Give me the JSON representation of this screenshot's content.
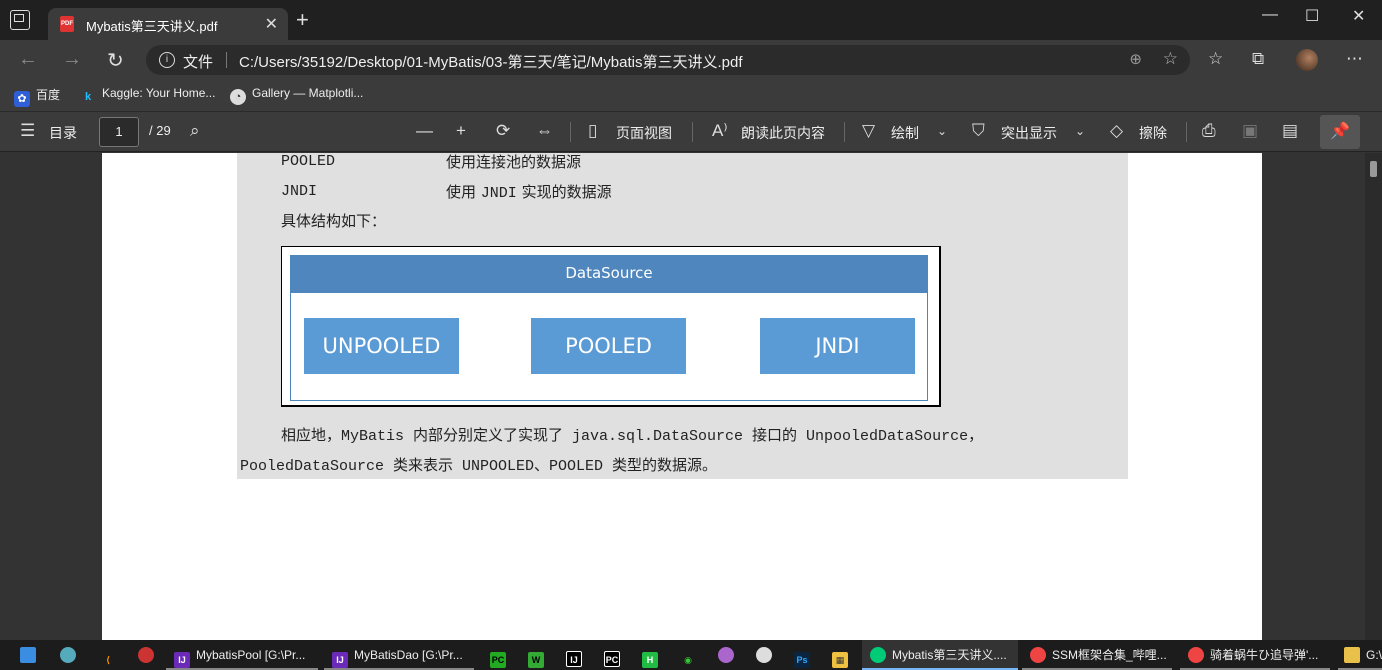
{
  "tab": {
    "title": "Mybatis第三天讲义.pdf",
    "icon": "pdf-icon",
    "icon_text": "PDF",
    "close": "✕"
  },
  "window": {
    "new_tab": "+",
    "minimize": "—",
    "maximize": "☐",
    "close": "✕"
  },
  "address": {
    "scheme_label": "文件",
    "url": "C:/Users/35192/Desktop/01-MyBatis/03-第三天/笔记/Mybatis第三天讲义.pdf"
  },
  "bookmarks": [
    {
      "label": "百度",
      "icon": "baidu-icon"
    },
    {
      "label": "Kaggle: Your Home...",
      "icon": "kaggle-icon"
    },
    {
      "label": "Gallery — Matplotli...",
      "icon": "matplotlib-icon"
    }
  ],
  "pdf_toolbar": {
    "toc_label": "目录",
    "page_current": "1",
    "page_total": "/ 29",
    "page_view_label": "页面视图",
    "read_aloud_label": "朗读此页内容",
    "draw_label": "绘制",
    "highlight_label": "突出显示",
    "erase_label": "擦除"
  },
  "document": {
    "row1_key": "POOLED",
    "row1_desc": "使用连接池的数据源",
    "row2_key": "JNDI",
    "row2_desc_prefix": "使用",
    "row2_desc_code": "JNDI",
    "row2_desc_suffix": "实现的数据源",
    "structure_label": "具体结构如下：",
    "figure": {
      "header": "DataSource",
      "boxes": [
        "UNPOOLED",
        "POOLED",
        "JNDI"
      ],
      "colors": {
        "header": "#4f86bd",
        "box": "#5b9bd5"
      }
    },
    "para_line1": "相应地，MyBatis 内部分别定义了实现了 java.sql.DataSource 接口的 UnpooledDataSource，",
    "para_line2": "PooledDataSource 类来表示 UNPOOLED、POOLED 类型的数据源。"
  },
  "taskbar": [
    {
      "label": "MybatisPool [G:\\Pr...",
      "icon": "intellij-icon"
    },
    {
      "label": "MyBatisDao [G:\\Pr...",
      "icon": "intellij-icon"
    },
    {
      "label": "Mybatis第三天讲义....",
      "icon": "edge-icon",
      "active": true
    },
    {
      "label": "SSM框架合集_哔哩...",
      "icon": "chrome-icon"
    },
    {
      "label": "骑着蜗牛ひ追导弹'...",
      "icon": "chrome-icon"
    },
    {
      "label": "G:\\",
      "icon": "folder-icon"
    }
  ]
}
